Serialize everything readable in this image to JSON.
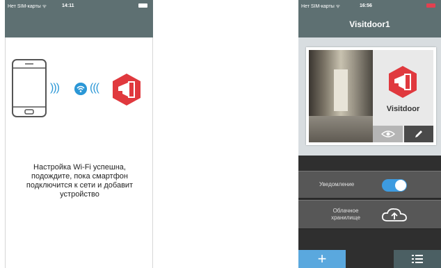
{
  "left_screen": {
    "status": {
      "carrier": "Нет SIM-карты ᯤ",
      "time": "14:11"
    },
    "message": "Настройка Wi-Fi успешна, подождите, пока смартфон подключится к сети и добавит устройство",
    "waves_left": ")))",
    "waves_right": "(((",
    "icons": [
      "smartphone-icon",
      "wifi-icon",
      "visitdoor-logo-icon"
    ]
  },
  "right_screen": {
    "status": {
      "carrier": "Нет SIM-карты ᯤ",
      "time": "16:56"
    },
    "title": "Visitdoor1",
    "camera": {
      "name": "Visitdoor"
    },
    "notification": {
      "label": "Уведомление",
      "enabled": true
    },
    "cloud": {
      "label": "Облачное хранилище"
    },
    "bottom_bar": {
      "add_label": "+"
    },
    "colors": {
      "accent": "#3d9be0",
      "brand_red": "#e0393e",
      "header": "#5e7072",
      "dark_bg": "#2f2f2f"
    }
  }
}
